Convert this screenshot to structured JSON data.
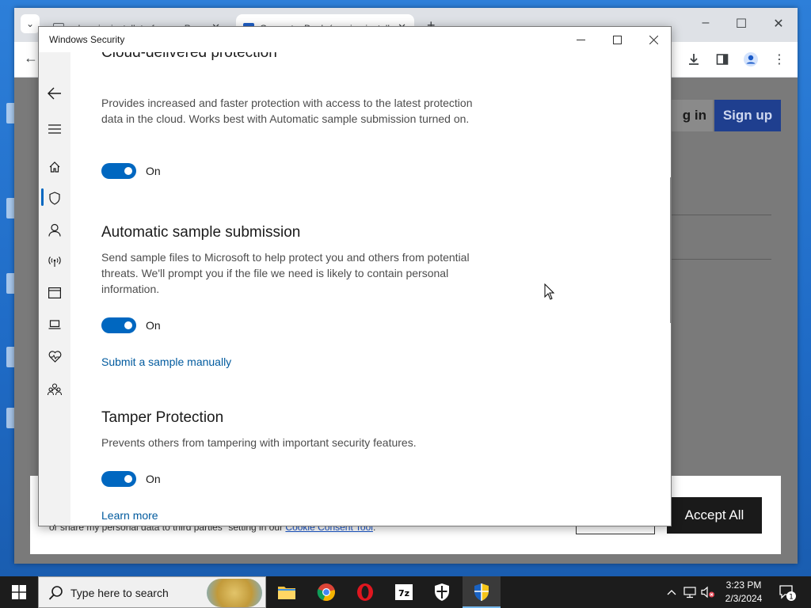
{
  "desktop": {},
  "browser": {
    "tabs": [
      {
        "label": "gdrussianinstallatorforum - Pa..."
      },
      {
        "label": "Geometry Dash (russian installe..."
      }
    ],
    "new_tab": "+",
    "page": {
      "login_label": "g in",
      "signup_label": "Sign up",
      "cookie": {
        "text_before": "or share my personal data to third parties\" setting in our ",
        "link": "Cookie Consent Tool",
        "text_after": ".",
        "accept_label": "Accept All"
      }
    }
  },
  "security_window": {
    "title": "Windows Security",
    "sections": [
      {
        "heading": "Cloud-delivered protection",
        "description": "Provides increased and faster protection with access to the latest protection data in the cloud. Works best with Automatic sample submission turned on.",
        "toggle_state": "On"
      },
      {
        "heading": "Automatic sample submission",
        "description": "Send sample files to Microsoft to help protect you and others from potential threats. We'll prompt you if the file we need is likely to contain personal information.",
        "toggle_state": "On",
        "link": "Submit a sample manually"
      },
      {
        "heading": "Tamper Protection",
        "description": "Prevents others from tampering with important security features.",
        "toggle_state": "On",
        "link": "Learn more"
      }
    ],
    "accent_color": "#0067c0",
    "link_color": "#005a9e"
  },
  "taskbar": {
    "search_placeholder": "Type here to search",
    "clock": {
      "time": "3:23 PM",
      "date": "2/3/2024"
    },
    "notification_count": "1",
    "apps": [
      "file-explorer-icon",
      "chrome-icon",
      "opera-icon",
      "7zip-icon",
      "windows-security-icon",
      "security-shield-icon"
    ]
  }
}
